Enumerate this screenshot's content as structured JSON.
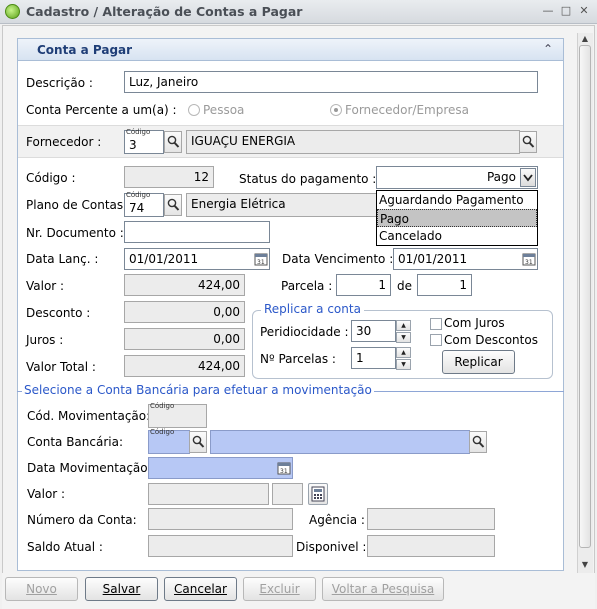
{
  "window": {
    "title": "Cadastro / Alteração de Contas a Pagar"
  },
  "panel": {
    "title": "Conta a Pagar"
  },
  "captions": {
    "codigo": "Código"
  },
  "fields": {
    "descricao": {
      "label": "Descrição :",
      "value": "Luz, Janeiro"
    },
    "conta_percente": {
      "label": "Conta Percente a um(a) :",
      "opt_pessoa": "Pessoa",
      "opt_fornecedor": "Fornecedor/Empresa"
    },
    "fornecedor": {
      "label": "Fornecedor :",
      "code": "3",
      "name": "IGUAÇU ENERGIA"
    },
    "codigo": {
      "label": "Código :",
      "value": "12"
    },
    "status": {
      "label": "Status do pagamento :",
      "value": "Pago",
      "options": [
        "Aguardando Pagamento",
        "Pago",
        "Cancelado"
      ]
    },
    "plano": {
      "label": "Plano de Contas:",
      "code": "74",
      "name": "Energia Elétrica"
    },
    "nr_documento": {
      "label": "Nr. Documento :",
      "value": ""
    },
    "data_lanc": {
      "label": "Data Lanç. :",
      "value": "01/01/2011"
    },
    "data_venc": {
      "label": "Data Vencimento :",
      "value": "01/01/2011"
    },
    "valor": {
      "label": "Valor :",
      "value": "424,00"
    },
    "parcela": {
      "label": "Parcela :",
      "de_label": "de",
      "value": "1",
      "total": "1"
    },
    "desconto": {
      "label": "Desconto :",
      "value": "0,00"
    },
    "juros": {
      "label": "Juros :",
      "value": "0,00"
    },
    "valor_total": {
      "label": "Valor Total :",
      "value": "424,00"
    }
  },
  "replicar": {
    "title": "Replicar a conta",
    "periodicidade_label": "Peridiocidade :",
    "periodicidade": "30",
    "parcelas_label": "Nº Parcelas :",
    "parcelas": "1",
    "com_juros": "Com Juros",
    "com_descontos": "Com Descontos",
    "button": "Replicar"
  },
  "bank": {
    "title": "Selecione a Conta Bancária para efetuar a movimentação",
    "cod_mov_label": "Cód. Movimentação:",
    "conta_label": "Conta Bancária:",
    "data_mov_label": "Data Movimentação:",
    "valor_label": "Valor :",
    "numero_label": "Número da Conta:",
    "agencia_label": "Agência :",
    "saldo_label": "Saldo Atual :",
    "disponivel_label": "Disponivel :"
  },
  "buttons": {
    "novo": "Novo",
    "salvar": "Salvar",
    "cancelar": "Cancelar",
    "excluir": "Excluir",
    "voltar": "Voltar a Pesquisa"
  }
}
